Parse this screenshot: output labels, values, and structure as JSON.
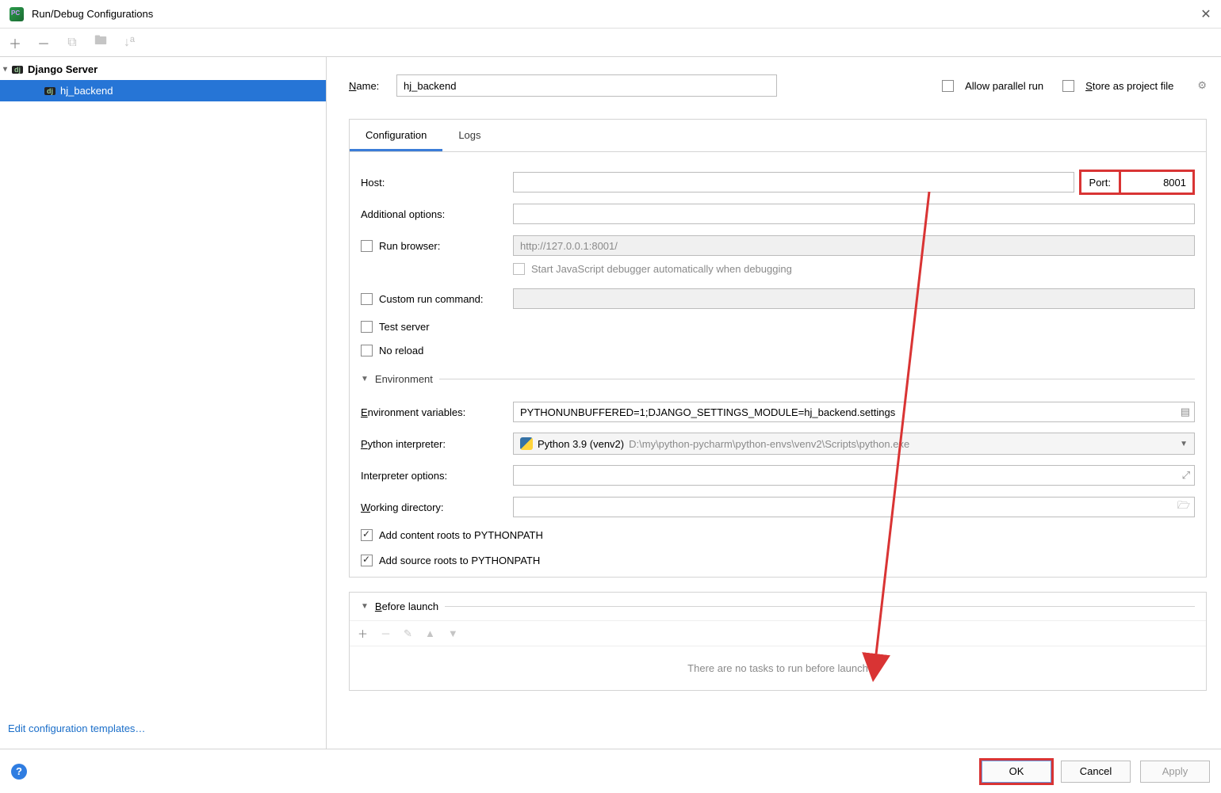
{
  "window": {
    "title": "Run/Debug Configurations"
  },
  "tree": {
    "root_label": "Django Server",
    "child_label": "hj_backend"
  },
  "templates_link": "Edit configuration templates…",
  "name_label": "Name:",
  "name_value": "hj_backend",
  "allow_parallel": "Allow parallel run",
  "store_project": "Store as project file",
  "tabs": {
    "configuration": "Configuration",
    "logs": "Logs"
  },
  "form": {
    "host_label": "Host:",
    "host_value": "",
    "port_label": "Port:",
    "port_value": "8001",
    "additional_label": "Additional options:",
    "additional_value": "",
    "run_browser_label": "Run browser:",
    "run_browser_url": "http://127.0.0.1:8001/",
    "start_js_dbg": "Start JavaScript debugger automatically when debugging",
    "custom_run_label": "Custom run command:",
    "custom_run_value": "",
    "test_server": "Test server",
    "no_reload": "No reload"
  },
  "env": {
    "section": "Environment",
    "env_vars_label": "Environment variables:",
    "env_vars_value": "PYTHONUNBUFFERED=1;DJANGO_SETTINGS_MODULE=hj_backend.settings",
    "interpreter_label": "Python interpreter:",
    "interpreter_name": "Python 3.9 (venv2)",
    "interpreter_path": "D:\\my\\python-pycharm\\python-envs\\venv2\\Scripts\\python.exe",
    "interpreter_opts_label": "Interpreter options:",
    "interpreter_opts_value": "",
    "workdir_label": "Working directory:",
    "workdir_value": "",
    "add_content_roots": "Add content roots to PYTHONPATH",
    "add_source_roots": "Add source roots to PYTHONPATH"
  },
  "before_launch": {
    "title": "Before launch",
    "empty": "There are no tasks to run before launch"
  },
  "footer": {
    "ok": "OK",
    "cancel": "Cancel",
    "apply": "Apply"
  }
}
